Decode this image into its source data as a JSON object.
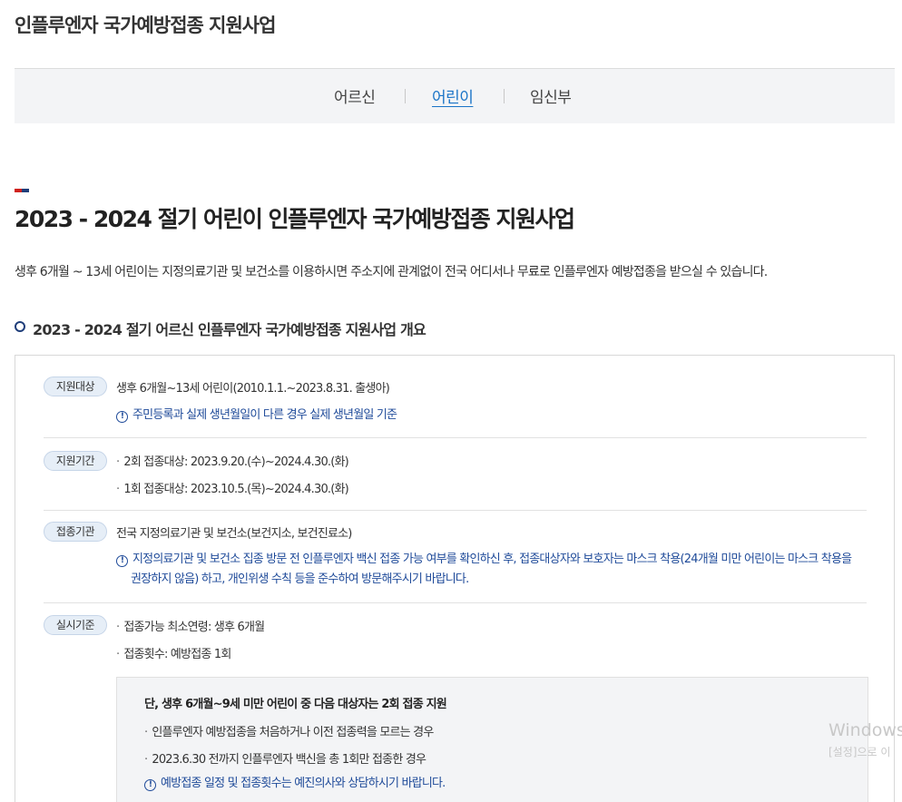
{
  "header": {
    "title": "인플루엔자 국가예방접종 지원사업"
  },
  "tabs": [
    {
      "label": "어르신",
      "active": false
    },
    {
      "label": "어린이",
      "active": true
    },
    {
      "label": "임신부",
      "active": false
    }
  ],
  "colors": {
    "accent_red": "#d0211c",
    "accent_navy": "#1f3e7a",
    "active_tab": "#1a74c7",
    "note_blue": "#1e4a99"
  },
  "main": {
    "title": "2023 - 2024 절기 어린이 인플루엔자 국가예방접종 지원사업",
    "intro": "생후 6개월 ~ 13세 어린이는 지정의료기관 및 보건소를 이용하시면 주소지에 관계없이 전국 어디서나 무료로 인플루엔자 예방접종을 받으실 수 있습니다.",
    "section_title": "2023 - 2024 절기 어르신 인플루엔자 국가예방접종 지원사업 개요"
  },
  "overview": {
    "target": {
      "badge": "지원대상",
      "text": "생후 6개월~13세 어린이(2010.1.1.~2023.8.31. 출생아)",
      "note": "주민등록과 실제 생년월일이 다른 경우 실제 생년월일 기준"
    },
    "period": {
      "badge": "지원기간",
      "items": [
        "2회 접종대상: 2023.9.20.(수)~2024.4.30.(화)",
        "1회 접종대상: 2023.10.5.(목)~2024.4.30.(화)"
      ]
    },
    "institution": {
      "badge": "접종기관",
      "text": "전국 지정의료기관 및 보건소(보건지소, 보건진료소)",
      "note_line1": "지정의료기관 및 보건소 집종 방문 전 인플루엔자 백신 접종 가능 여부를 확인하신 후, 접종대상자와 보호자는 마스크 착용(24개월 미만 어린이는 마스크 착용을",
      "note_line2": "권장하지 않음) 하고, 개인위생 수칙 등을 준수하여 방문해주시기 바랍니다."
    },
    "criteria": {
      "badge": "실시기준",
      "items": [
        "접종가능 최소연령: 생후 6개월",
        "접종횟수: 예방접종 1회"
      ],
      "inner": {
        "title": "단, 생후 6개월~9세 미만 어린이 중 다음 대상자는 2회 접종 지원",
        "items": [
          "인플루엔자 예방접종을 처음하거나 이전 접종력을 모르는 경우",
          "2023.6.30 전까지 인플루엔자 백신을 총 1회만 접종한 경우"
        ],
        "note": "예방접종 일정 및 접종횟수는 예진의사와 상담하시기 바랍니다."
      }
    }
  },
  "watermark": {
    "line1": "Windows",
    "line2": "[설정]으로 이"
  }
}
